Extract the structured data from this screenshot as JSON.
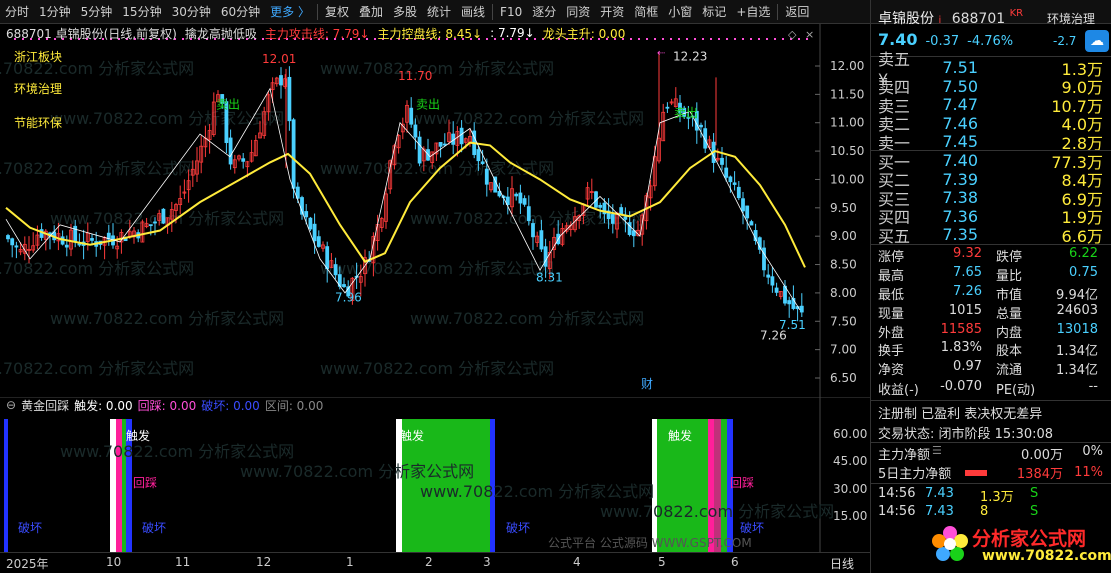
{
  "toolbar": {
    "items": [
      "分时",
      "1分钟",
      "5分钟",
      "15分钟",
      "30分钟",
      "60分钟",
      "更多 〉",
      "复权",
      "叠加",
      "多股",
      "统计",
      "画线",
      "F10",
      "逐分",
      "同资",
      "开资",
      "简框",
      "小窗",
      "标记",
      "+自选",
      "返回"
    ]
  },
  "chart_info": {
    "code_name": "688701 卓锦股份(日线,前复权)",
    "indicator": "擒龙高抛低吸",
    "attack_line": "主力攻击线: 7.79↓",
    "control_line": "主力控盘线: 8.45↓",
    "blank_line": ": 7.79↓",
    "leader_rise": "龙头主升: 0.00"
  },
  "sectors": [
    "浙江板块",
    "环境治理",
    "节能环保"
  ],
  "annotations": {
    "sell": "卖出",
    "high1": "12.01",
    "high2": "11.70",
    "high3": "12.23",
    "low1": "7.96",
    "low2": "8.31",
    "low3": "7.26",
    "last": "7.51",
    "cai": "财"
  },
  "watermark": "www.70822.com 分析家公式网",
  "subchart": {
    "title": "黄金回踩",
    "trigger": "触发: 0.00",
    "pullback": "回踩: 0.00",
    "break": "破坏: 0.00",
    "interval": "区间: 0.00",
    "labels": {
      "trigger": "触发",
      "pullback": "回踩",
      "break": "破坏"
    },
    "yticks": [
      "60.00",
      "45.00",
      "30.00",
      "15.00"
    ],
    "footer": "公式平台 公式源码 WWW.GSPT.COM"
  },
  "time_axis": {
    "labels": [
      "2025年",
      "10",
      "11",
      "12",
      "1",
      "2",
      "3",
      "4",
      "5",
      "6"
    ],
    "mode": "日线"
  },
  "price_axis": [
    "12.00",
    "11.50",
    "11.00",
    "10.50",
    "10.00",
    "9.50",
    "9.00",
    "8.50",
    "8.00",
    "7.50",
    "7.00",
    "6.50"
  ],
  "stock": {
    "name": "卓锦股份",
    "code": "688701",
    "kr": "KR",
    "price": "7.40",
    "change": "-0.37",
    "pct": "-4.76%",
    "sector_tag": "环境治理",
    "sector_pct": "-2.7"
  },
  "order_book": {
    "sell": [
      [
        "卖五 ¥",
        "7.51",
        "1.3万"
      ],
      [
        "卖四",
        "7.50",
        "9.0万"
      ],
      [
        "卖三",
        "7.47",
        "10.7万"
      ],
      [
        "卖二",
        "7.46",
        "4.0万"
      ],
      [
        "卖一",
        "7.45",
        "2.8万"
      ]
    ],
    "buy": [
      [
        "买一",
        "7.40",
        "77.3万"
      ],
      [
        "买二",
        "7.39",
        "8.4万"
      ],
      [
        "买三",
        "7.38",
        "6.9万"
      ],
      [
        "买四",
        "7.36",
        "1.9万"
      ],
      [
        "买五",
        "7.35",
        "6.6万"
      ]
    ]
  },
  "stats": [
    [
      "涨停",
      "9.32",
      "跌停",
      "6.22"
    ],
    [
      "最高",
      "7.65",
      "量比",
      "0.75"
    ],
    [
      "最低",
      "7.26",
      "市值",
      "9.94亿"
    ],
    [
      "现量",
      "1015",
      "总量",
      "24603"
    ],
    [
      "外盘",
      "11585",
      "内盘",
      "13018"
    ],
    [
      "换手",
      "1.83%",
      "股本",
      "1.34亿"
    ],
    [
      "净资",
      "0.97",
      "流通",
      "1.34亿"
    ],
    [
      "收益(-)",
      "-0.070",
      "PE(动)",
      "--"
    ]
  ],
  "status": {
    "line1": "注册制 已盈利 表决权无差异",
    "line2": "交易状态: 闭市阶段 15:30:08",
    "net_label": "主力净额",
    "net_val": "0.00万",
    "net_pct": "0%",
    "net5_label": "5日主力净额",
    "net5_val": "1384万",
    "net5_pct": "11%"
  },
  "ticks": [
    [
      "14:56",
      "7.43",
      "1.3万",
      "S"
    ],
    [
      "14:56",
      "7.43",
      "8",
      "S"
    ]
  ],
  "brand": {
    "name": "分析家公式网",
    "url": "www.70822.com"
  },
  "colors": {
    "up": "#ff3b3b",
    "down": "#4ad0ff",
    "ma": "#ffeb3b",
    "accent": "#3fa9ff"
  }
}
